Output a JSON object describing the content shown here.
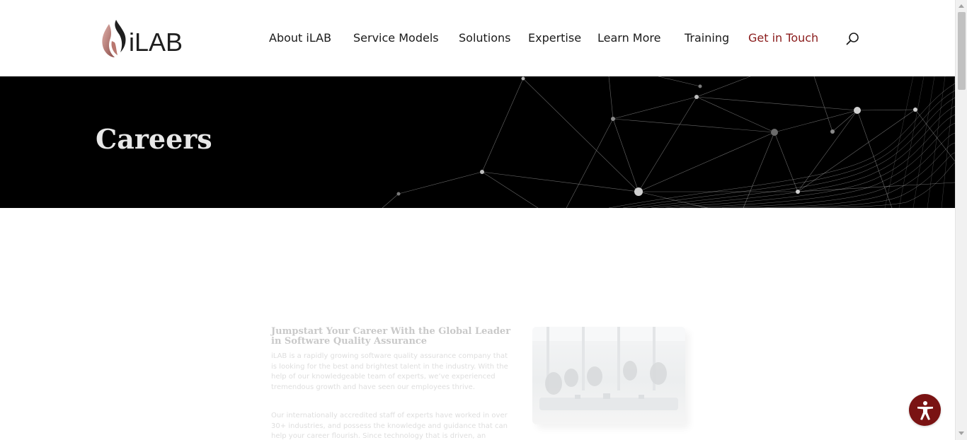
{
  "logo": {
    "text": "iLAB"
  },
  "nav": {
    "items": [
      {
        "label": "About iLAB",
        "accent": false
      },
      {
        "label": "Service Models",
        "accent": false
      },
      {
        "label": "Solutions",
        "accent": false
      },
      {
        "label": "Expertise",
        "accent": false
      },
      {
        "label": "Learn More",
        "accent": false
      },
      {
        "label": "Training",
        "accent": false
      },
      {
        "label": "Get in Touch",
        "accent": true
      }
    ]
  },
  "hero": {
    "title": "Careers"
  },
  "content": {
    "heading": "Jumpstart Your Career With the Global Leader in Software Quality Assurance",
    "paragraph1": "iLAB is a rapidly growing software quality assurance company that is looking for the best and brightest talent in the industry. With the help of our knowledgeable team of experts, we’ve experienced tremendous growth and have seen our employees thrive.",
    "paragraph2": "Our internationally accredited staff of experts have worked in over 30+ industries, and possess the knowledge and guidance that can help your career flourish. Since technology that is driven, an"
  },
  "colors": {
    "accent": "#8a1b1b",
    "hero_bg": "#000000",
    "a11y_button": "#7a1313"
  },
  "icons": {
    "search": "search-icon",
    "accessibility": "accessibility-icon",
    "logo_mark": "flame-logo-icon"
  }
}
